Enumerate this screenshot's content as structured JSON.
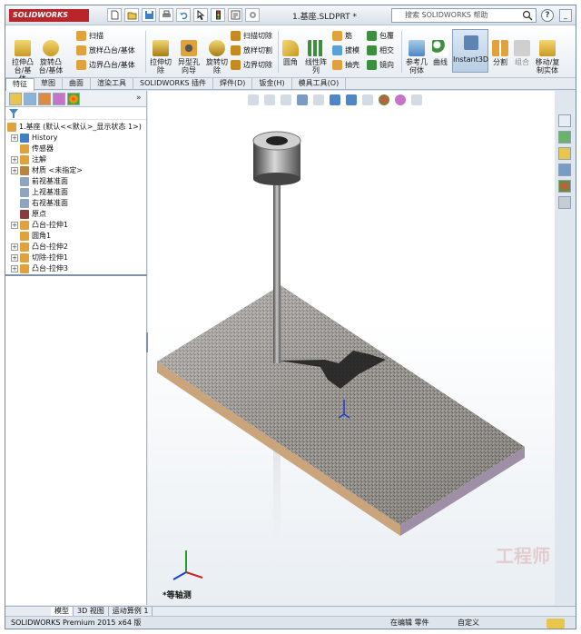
{
  "app": {
    "logo": "SOLIDWORKS",
    "document_title": "1.基座.SLDPRT *",
    "search_placeholder": "搜索 SOLIDWORKS 帮助",
    "help_label": "?",
    "minimize_label": "_"
  },
  "ribbon": {
    "extrude_boss": "拉伸凸台/基体",
    "revolve_boss": "旋转凸台/基体",
    "sweep": "扫描",
    "loft_boss": "放样凸台/基体",
    "boundary_boss": "边界凸台/基体",
    "extrude_cut": "拉伸切除",
    "hole_wizard": "异型孔向导",
    "revolve_cut": "旋转切除",
    "swept_cut": "扫描切除",
    "lofted_cut": "放样切割",
    "boundary_cut": "边界切除",
    "fillet": "圆角",
    "linear_pattern": "线性阵列",
    "rib": "筋",
    "draft": "拔模",
    "shell": "抽壳",
    "wrap": "包覆",
    "intersect": "相交",
    "mirror": "镜向",
    "reference_geometry": "参考几何体",
    "curves": "曲线",
    "instant3d": "Instant3D",
    "split": "分割",
    "combine": "组合",
    "move_copy": "移动/复制实体"
  },
  "tabs": [
    {
      "label": "特征",
      "active": true
    },
    {
      "label": "草图"
    },
    {
      "label": "曲面"
    },
    {
      "label": "渲染工具"
    },
    {
      "label": "SOLIDWORKS 插件"
    },
    {
      "label": "焊件(D)"
    },
    {
      "label": "钣金(H)"
    },
    {
      "label": "模具工具(O)"
    }
  ],
  "tree": {
    "root": "1.基座 (默认<<默认>_显示状态 1>)",
    "items": [
      {
        "label": "History",
        "expandable": true,
        "color": "#3f7fc7"
      },
      {
        "label": "传感器",
        "expandable": false,
        "color": "#e2a23b"
      },
      {
        "label": "注解",
        "expandable": true,
        "color": "#e2a23b"
      },
      {
        "label": "材质 <未指定>",
        "expandable": true,
        "color": "#b9853b"
      },
      {
        "label": "前视基准面",
        "expandable": false,
        "color": "#8fa4bf"
      },
      {
        "label": "上视基准面",
        "expandable": false,
        "color": "#8fa4bf"
      },
      {
        "label": "右视基准面",
        "expandable": false,
        "color": "#8fa4bf"
      },
      {
        "label": "原点",
        "expandable": false,
        "color": "#8b3b3b"
      },
      {
        "label": "凸台-拉伸1",
        "expandable": true,
        "color": "#e2a23b"
      },
      {
        "label": "圆角1",
        "expandable": false,
        "color": "#e2a23b"
      },
      {
        "label": "凸台-拉伸2",
        "expandable": true,
        "color": "#e2a23b"
      },
      {
        "label": "切除-拉伸1",
        "expandable": true,
        "color": "#e2a23b"
      },
      {
        "label": "凸台-拉伸3",
        "expandable": true,
        "color": "#e2a23b"
      }
    ]
  },
  "viewport": {
    "view_name": "*等轴测",
    "watermark": "工程师"
  },
  "model_tabs": [
    {
      "label": "模型",
      "active": true
    },
    {
      "label": "3D 视图"
    },
    {
      "label": "运动算例 1"
    }
  ],
  "statusbar": {
    "product": "SOLIDWORKS Premium 2015 x64 版",
    "editing": "在编辑 零件",
    "units": "自定义"
  },
  "colors": {
    "accent": "#3f7fc7",
    "ribbon_bg": "#e8edf3",
    "viewport_bg": "#ffffff",
    "part_metal": "#8e8a86",
    "shadow": "#1a1a1a"
  }
}
